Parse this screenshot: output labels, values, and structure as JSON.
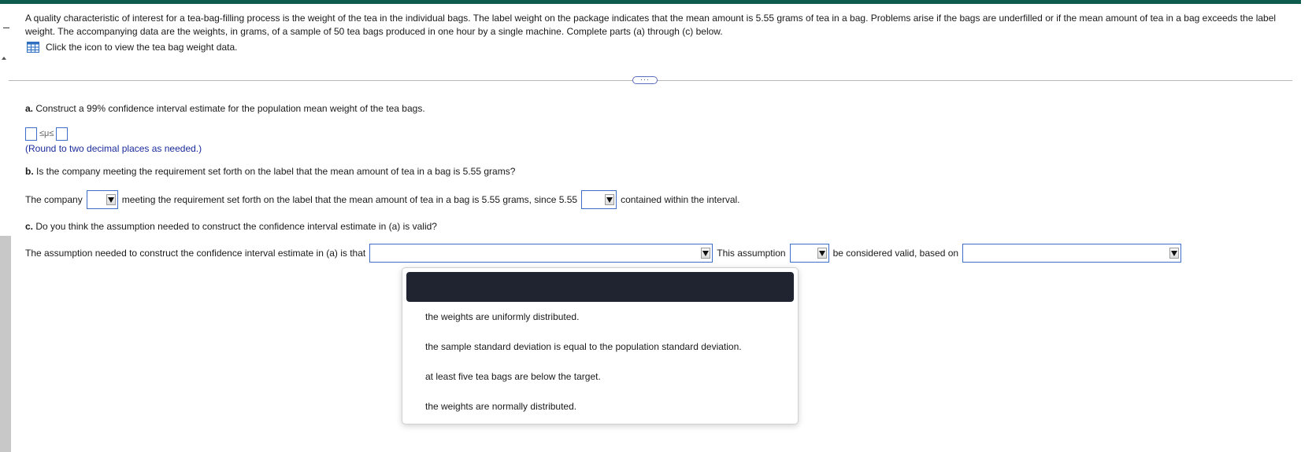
{
  "intro": {
    "text": "A quality characteristic of interest for a tea-bag-filling process is the weight of the tea in the individual bags. The label weight on the package indicates that the mean amount is 5.55 grams of tea in a bag. Problems arise if the bags are underfilled or if the mean amount of tea in a bag exceeds the label weight. The accompanying data are the weights, in grams, of a sample of 50 tea bags produced in one hour by a single machine. Complete parts (a) through (c) below.",
    "data_link": "Click the icon to view the tea bag weight data."
  },
  "more_button": "···",
  "part_a": {
    "question_bold": "a.",
    "question": " Construct a 99% confidence interval estimate for the population mean weight of the tea bags.",
    "symbol": "≤μ≤",
    "note": "(Round to two decimal places as needed.)"
  },
  "part_b": {
    "question_bold": "b.",
    "question": " Is the company meeting the requirement set forth on the label that the mean amount of tea in a bag is 5.55 grams?",
    "answer_prefix": "The company",
    "answer_middle": "meeting the requirement set forth on the label that the mean amount of tea in a bag is 5.55 grams, since 5.55",
    "answer_suffix": "contained within the interval."
  },
  "part_c": {
    "question_bold": "c.",
    "question": " Do you think the assumption needed to construct the confidence interval estimate in (a) is valid?",
    "answer_prefix": "The assumption needed to construct the confidence interval estimate in (a) is that",
    "answer_middle": "This assumption",
    "answer_suffix": "be considered valid, based on"
  },
  "dropdown_options": [
    "the weights are uniformly distributed.",
    "the sample standard deviation is equal to the population standard deviation.",
    "at least five tea bags are below the target.",
    "the weights are normally distributed."
  ],
  "colors": {
    "accent_bar": "#0e5c4e",
    "input_border": "#3d6ec9",
    "note_text": "#1b2b9b",
    "highlight": "#1f2430"
  },
  "icons": [
    "table-grid-icon",
    "dropdown-arrow-icon"
  ]
}
